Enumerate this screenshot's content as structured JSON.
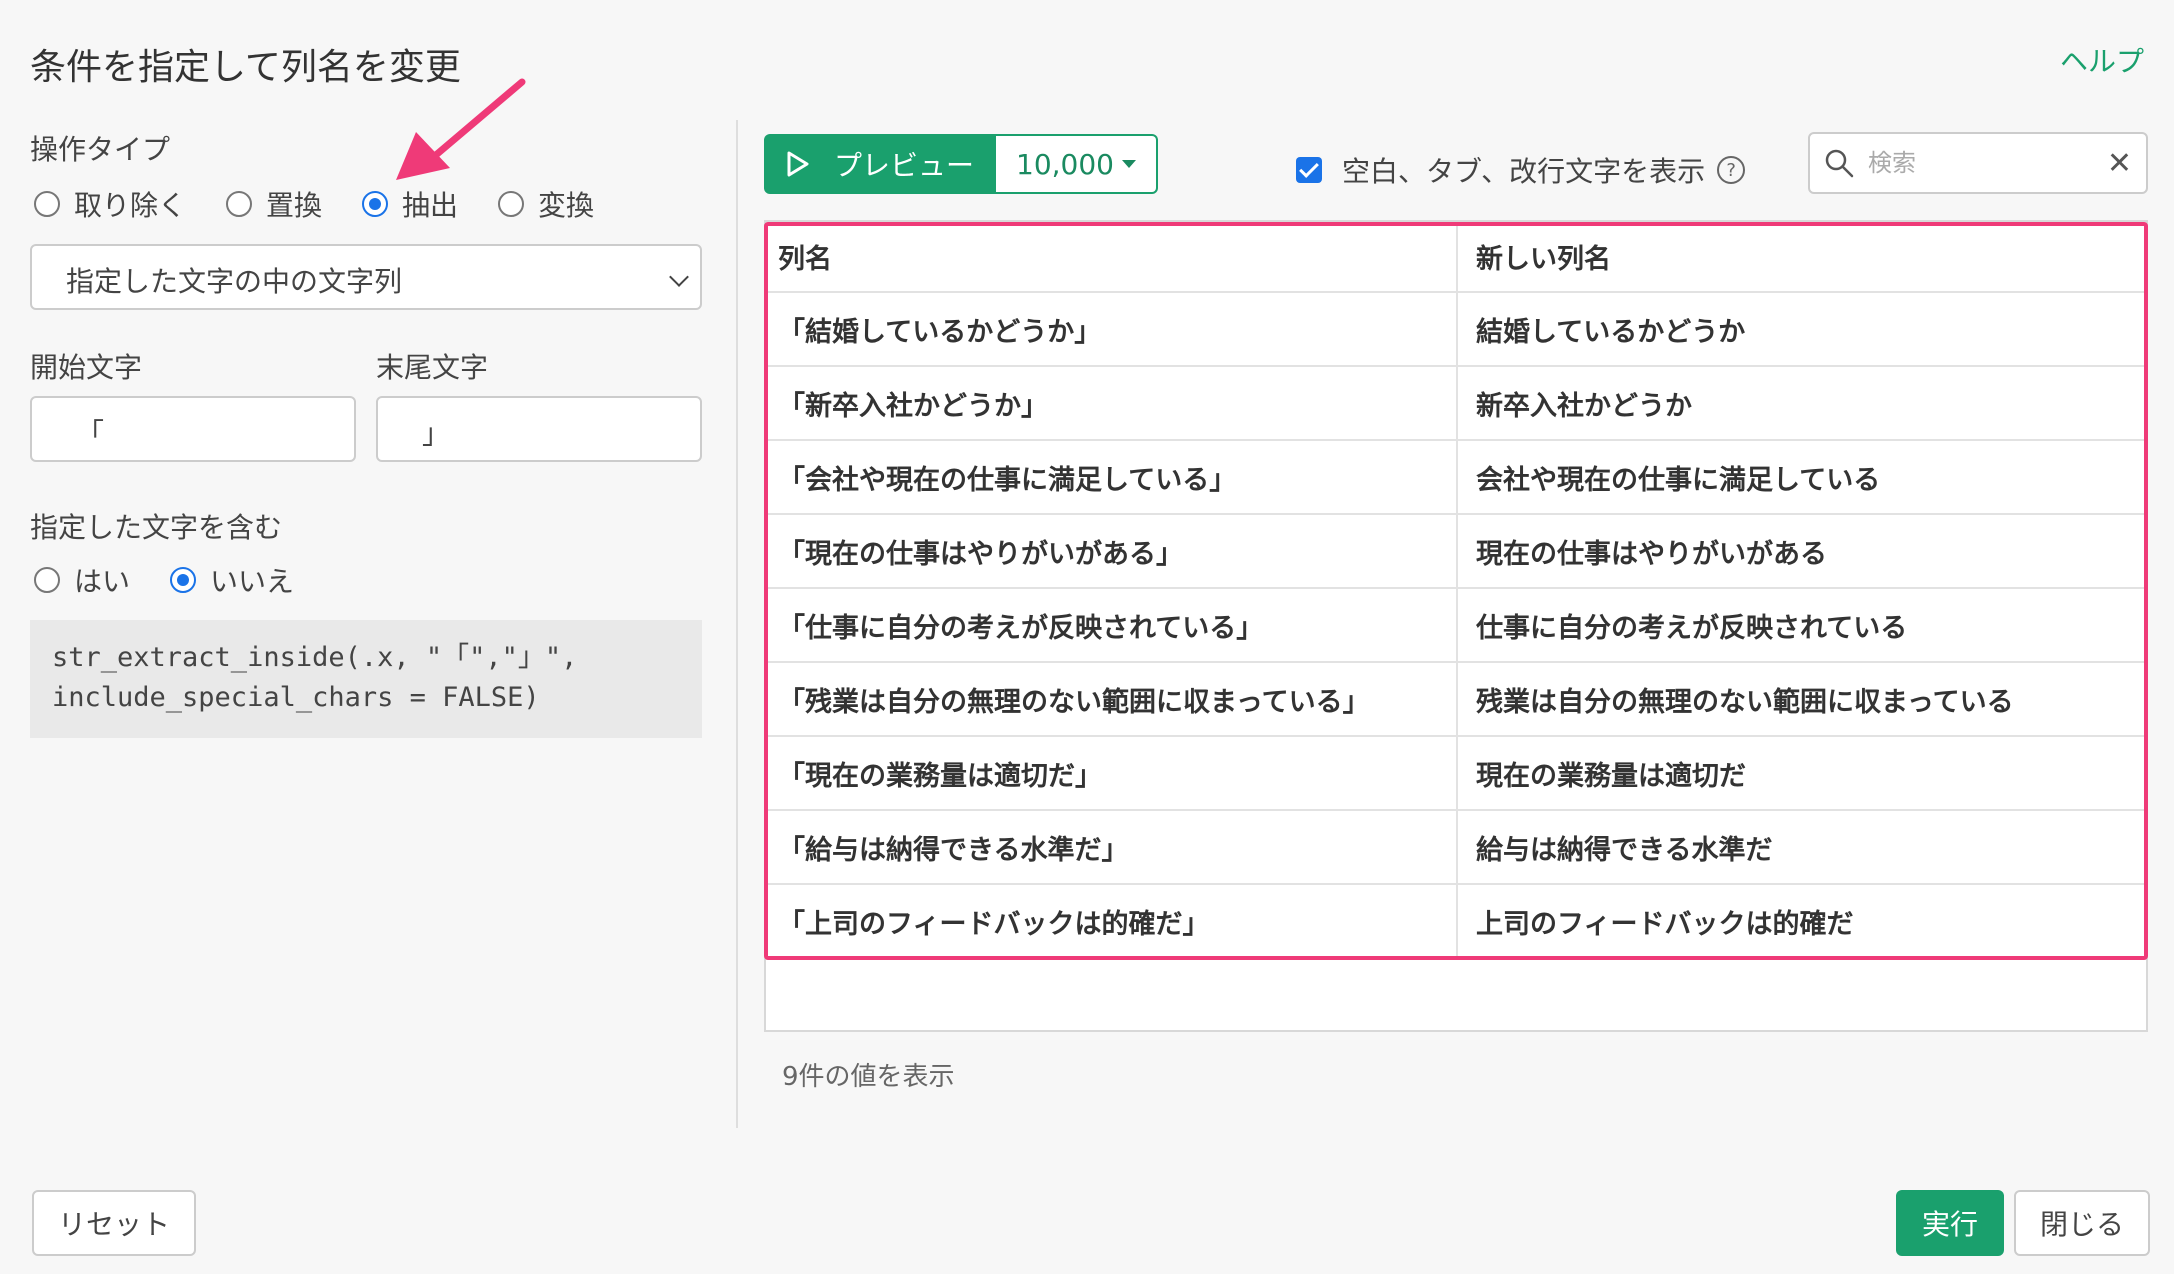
{
  "header": {
    "title": "条件を指定して列名を変更",
    "help": "ヘルプ"
  },
  "operation": {
    "label": "操作タイプ",
    "options": [
      "取り除く",
      "置換",
      "抽出",
      "変換"
    ],
    "selected": "抽出"
  },
  "extract_mode": {
    "selected": "指定した文字の中の文字列"
  },
  "start_char": {
    "label": "開始文字",
    "value": "「"
  },
  "end_char": {
    "label": "末尾文字",
    "value": "」"
  },
  "include": {
    "label": "指定した文字を含む",
    "options": [
      "はい",
      "いいえ"
    ],
    "selected": "いいえ"
  },
  "code": "str_extract_inside(.x, \"「\",\"」\",\ninclude_special_chars = FALSE)",
  "preview": {
    "button_label": "プレビュー",
    "count": "10,000",
    "show_whitespace_label": "空白、タブ、改行文字を表示",
    "show_whitespace_checked": true,
    "search_placeholder": "検索"
  },
  "table": {
    "columns": [
      "列名",
      "新しい列名"
    ],
    "rows": [
      [
        "「結婚しているかどうか」",
        "結婚しているかどうか"
      ],
      [
        "「新卒入社かどうか」",
        "新卒入社かどうか"
      ],
      [
        "「会社や現在の仕事に満足している」",
        "会社や現在の仕事に満足している"
      ],
      [
        "「現在の仕事はやりがいがある」",
        "現在の仕事はやりがいがある"
      ],
      [
        "「仕事に自分の考えが反映されている」",
        "仕事に自分の考えが反映されている"
      ],
      [
        "「残業は自分の無理のない範囲に収まっている」",
        "残業は自分の無理のない範囲に収まっている"
      ],
      [
        "「現在の業務量は適切だ」",
        "現在の業務量は適切だ"
      ],
      [
        "「給与は納得できる水準だ」",
        "給与は納得できる水準だ"
      ],
      [
        "「上司のフィードバックは的確だ」",
        "上司のフィードバックは的確だ"
      ]
    ],
    "summary": "9件の値を表示"
  },
  "footer": {
    "reset": "リセット",
    "run": "実行",
    "close": "閉じる"
  },
  "colors": {
    "accent": "#1aa06d",
    "highlight": "#ef3a78",
    "radio": "#1a73e8"
  }
}
